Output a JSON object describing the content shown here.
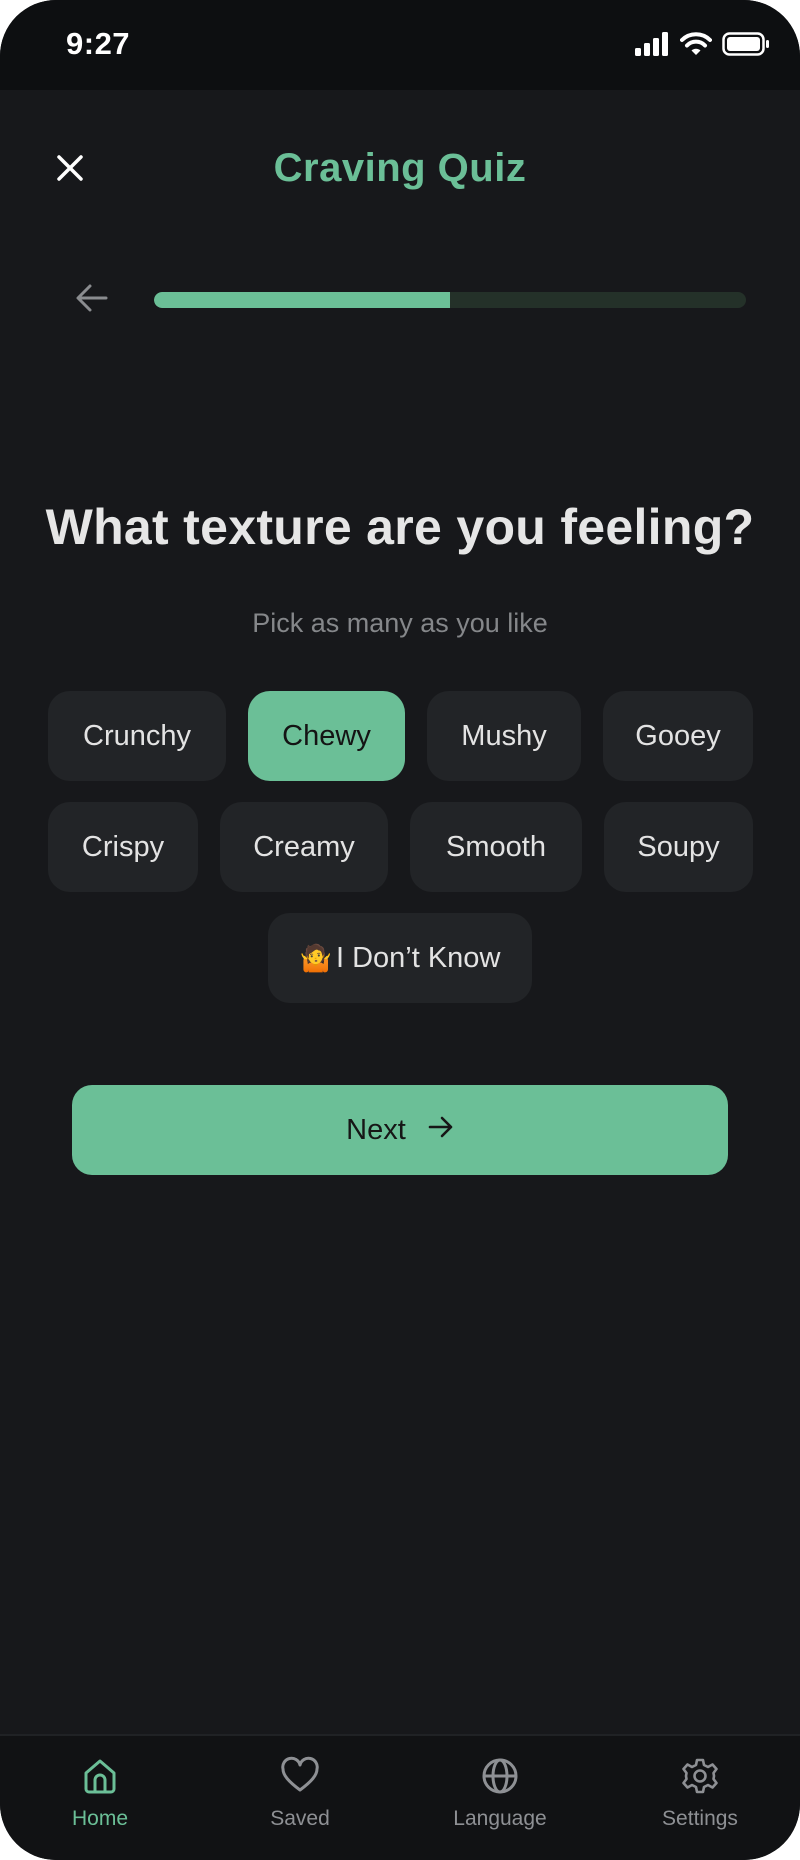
{
  "status_bar": {
    "time": "9:27",
    "icons": [
      "signal-icon",
      "wifi-icon",
      "battery-icon"
    ]
  },
  "header": {
    "title": "Craving Quiz",
    "close_icon": "close-icon"
  },
  "progress": {
    "fraction": 0.5,
    "back_icon": "arrow-left-icon"
  },
  "question": {
    "title": "What texture are you feeling?",
    "subtitle": "Pick as many as you like"
  },
  "options": [
    {
      "label": "Crunchy",
      "selected": false
    },
    {
      "label": "Chewy",
      "selected": true
    },
    {
      "label": "Mushy",
      "selected": false
    },
    {
      "label": "Gooey",
      "selected": false
    },
    {
      "label": "Crispy",
      "selected": false
    },
    {
      "label": "Creamy",
      "selected": false
    },
    {
      "label": "Smooth",
      "selected": false
    },
    {
      "label": "Soupy",
      "selected": false
    },
    {
      "label": "I Don’t Know",
      "selected": false,
      "emoji": "🤷"
    }
  ],
  "next_button": {
    "label": "Next",
    "icon": "arrow-right-icon"
  },
  "bottom_nav": {
    "items": [
      {
        "label": "Home",
        "icon": "home-icon",
        "active": true
      },
      {
        "label": "Saved",
        "icon": "heart-icon",
        "active": false
      },
      {
        "label": "Language",
        "icon": "globe-icon",
        "active": false
      },
      {
        "label": "Settings",
        "icon": "gear-icon",
        "active": false
      }
    ]
  },
  "colors": {
    "accent": "#6bbf97",
    "background": "#17181b",
    "chip": "#222427",
    "progress_track": "#243129"
  }
}
